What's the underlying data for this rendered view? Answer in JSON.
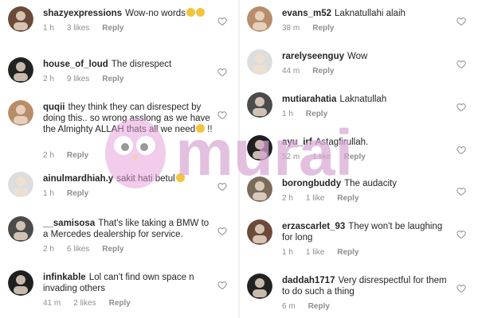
{
  "left_comments": [
    {
      "username": "shazyexpressions",
      "text": "Wow-no words",
      "emoji_count": 2,
      "time": "1 h",
      "likes": "3 likes",
      "reply": "Reply"
    },
    {
      "username": "house_of_loud",
      "text": "The disrespect",
      "emoji_count": 0,
      "time": "2 h",
      "likes": "9 likes",
      "reply": "Reply"
    },
    {
      "username": "quqii",
      "text": "they think they can disrespect by doing this.. so wrong asslong as we have the Almighty ALLAH thats all we need",
      "emoji_count": 1,
      "suffix": "!!",
      "time": "2 h",
      "likes": "",
      "reply": "Reply"
    },
    {
      "username": "ainulmardhiah.y",
      "text": "sakit hati betul",
      "emoji_count": 1,
      "time": "1 h",
      "likes": "",
      "reply": "Reply"
    },
    {
      "username": "__samisosa",
      "text": "That's like taking a BMW to a Mercedes dealership for service.",
      "emoji_count": 0,
      "time": "2 h",
      "likes": "6 likes",
      "reply": "Reply"
    },
    {
      "username": "infinkable",
      "text": "Lol can't find own space n invading others",
      "emoji_count": 0,
      "time": "41 m",
      "likes": "2 likes",
      "reply": "Reply"
    }
  ],
  "right_comments": [
    {
      "username": "evans_m52",
      "text": "Laknatullahi alaih",
      "time": "38 m",
      "likes": "",
      "reply": "Reply"
    },
    {
      "username": "rarelyseenguy",
      "text": "Wow",
      "time": "44 m",
      "likes": "",
      "reply": "Reply"
    },
    {
      "username": "mutiarahatia",
      "text": "Laknatullah",
      "time": "1 h",
      "likes": "",
      "reply": "Reply"
    },
    {
      "username": "ayu_irf",
      "text": "Astagfirullah.",
      "time": "52 m",
      "likes": "1 like",
      "reply": "Reply"
    },
    {
      "username": "borongbuddy",
      "text": "The audacity",
      "time": "2 h",
      "likes": "1 like",
      "reply": "Reply"
    },
    {
      "username": "erzascarlet_93",
      "text": "They won't be laughing for long",
      "time": "1 h",
      "likes": "1 like",
      "reply": "Reply"
    },
    {
      "username": "daddah1717",
      "text": "Very disrespectful for them to do such a thing",
      "time": "6 m",
      "likes": "",
      "reply": "Reply"
    }
  ],
  "watermark": {
    "text": "murai",
    "color": "#d9a6d4"
  },
  "colors": {
    "meta": "#8e8e8e",
    "emoji": "#f5c33b"
  }
}
